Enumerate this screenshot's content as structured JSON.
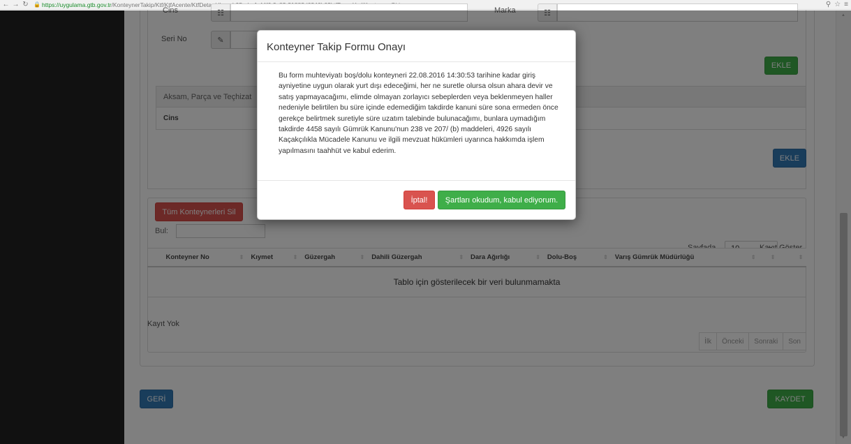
{
  "browser": {
    "url_host": "https://uygulama.gtb.gov.tr",
    "url_path": "/KonteynerTakip/Ktf/KtfAcente/KtfDetay/dbcaab95-aba1-44f6-9c83-31883d6246b6?ktfTuru=YerliKonteynerGiris"
  },
  "form": {
    "cins_label": "Cins",
    "marka_label": "Marka",
    "seri_no_label": "Seri No",
    "ekle_label": "EKLE",
    "ekle2_label": "EKLE"
  },
  "parts": {
    "header": "Aksam, Parça ve Teçhizat",
    "row_label": "Cins"
  },
  "containers": {
    "delete_all_label": "Tüm Konteynerleri Sil",
    "search_label": "Bul:",
    "page_size_prefix": "Sayfada",
    "page_size_value": "10",
    "page_size_suffix": "Kayıt Göster",
    "columns": [
      "Konteyner No",
      "Kıymet",
      "Güzergah",
      "Dahili Güzergah",
      "Dara Ağırlığı",
      "Dolu-Boş",
      "Varış Gümrük Müdürlüğü"
    ],
    "empty_message": "Tablo için gösterilecek bir veri bulunmamakta",
    "record_info": "Kayıt Yok",
    "pager": [
      "İlk",
      "Önceki",
      "Sonraki",
      "Son"
    ]
  },
  "footer": {
    "back_label": "GERİ",
    "save_label": "KAYDET"
  },
  "modal": {
    "title": "Konteyner Takip Formu Onayı",
    "body": "Bu form muhteviyatı boş/dolu konteyneri 22.08.2016 14:30:53 tarihine kadar giriş ayniyetine uygun olarak yurt dışı edeceğimi, her ne suretle olursa olsun ahara devir ve satış yapmayacağımı, elimde olmayan zorlayıcı sebeplerden veya beklenmeyen haller nedeniyle belirtilen bu süre içinde edemediğim takdirde kanuni süre sona ermeden önce gerekçe belirtmek suretiyle süre uzatım talebinde bulunacağımı, bunlara uymadığım takdirde 4458 sayılı Gümrük Kanunu'nun 238 ve 207/ (b) maddeleri, 4926 sayılı Kaçakçılıkla Mücadele Kanunu ve ilgili mevzuat hükümleri uyarınca hakkımda işlem yapılmasını taahhüt ve kabul ederim.",
    "cancel_label": "İptal!",
    "accept_label": "Şartları okudum, kabul ediyorum."
  },
  "colors": {
    "green": "#3fae49",
    "blue": "#337ab7",
    "red": "#d9534f",
    "sidebar": "#222222"
  }
}
